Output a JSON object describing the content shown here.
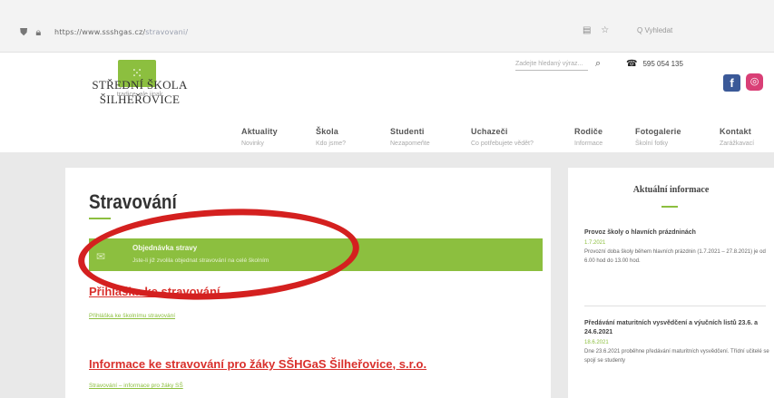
{
  "browser": {
    "url_host": "https://www.ssshgas.cz/",
    "url_path": "stravovani/",
    "search_placeholder": "Q Vyhledat"
  },
  "header": {
    "logo_glyph": "⁙",
    "school_name": "STŘEDNÍ ŠKOLA ŠILHEŘOVICE",
    "school_tagline": "tradice, ale jinak",
    "search_placeholder": "Zadejte hledaný výraz...",
    "phone": "595 054 135",
    "nav": [
      {
        "main": "Aktuality",
        "sub": "Novinky"
      },
      {
        "main": "Škola",
        "sub": "Kdo jsme?"
      },
      {
        "main": "Studenti",
        "sub": "Nezapomeňte"
      },
      {
        "main": "Uchazeči",
        "sub": "Co potřebujete vědět?"
      },
      {
        "main": "Rodiče",
        "sub": "Informace"
      },
      {
        "main": "Fotogalerie",
        "sub": "Školní fotky"
      },
      {
        "main": "Kontakt",
        "sub": "Zarážkavací"
      }
    ]
  },
  "main": {
    "title": "Stravování",
    "order_title": "Objednávka stravy",
    "order_sub": "Jste-li již zvolila objednat stravování na celé školním",
    "link1": "Přihláška ke stravování",
    "link1_sub": "Přihláška ke školnímu stravování",
    "link2": "Informace ke stravování pro žáky SŠHGaS Šilheřovice, s.r.o.",
    "link2_sub": "Stravování – informace pro žáky SŠ"
  },
  "sidebar": {
    "title": "Aktuální informace",
    "news": [
      {
        "title": "Provoz školy o hlavních prázdninách",
        "date": "1.7.2021",
        "text": "Provozní doba školy během hlavních prázdnin (1.7.2021 – 27.8.2021) je od 6.00 hod do 13.00 hod."
      },
      {
        "title": "Předávání maturitních vysvědčení a výučních listů 23.6. a 24.6.2021",
        "date": "18.6.2021",
        "text": "Dne 23.6.2021 proběhne předávání maturitních vysvědčení. Třídní učitelé se spojí se studenty"
      }
    ]
  }
}
